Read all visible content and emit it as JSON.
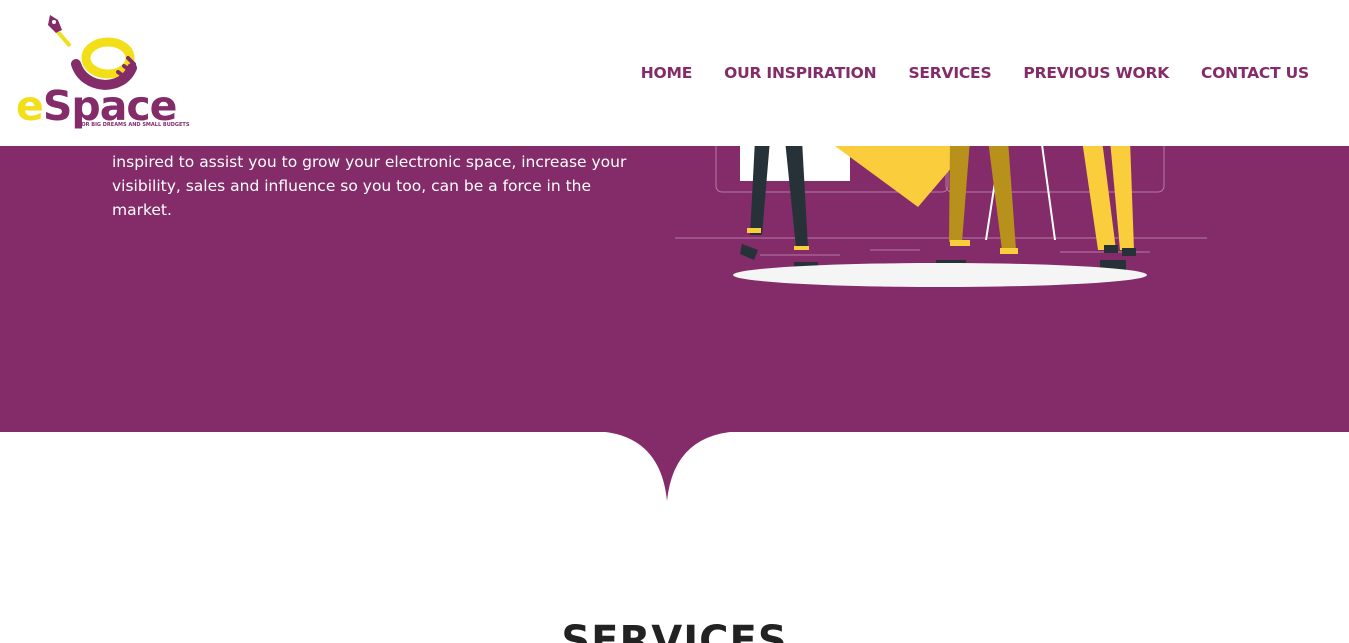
{
  "brand": {
    "name_e": "e",
    "name_rest": "Space",
    "tagline": "FOR BIG DREAMS AND SMALL BUDGETS",
    "colors": {
      "primary": "#832c69",
      "accent": "#f2df1a"
    }
  },
  "nav": {
    "items": [
      {
        "label": "HOME"
      },
      {
        "label": "OUR INSPIRATION"
      },
      {
        "label": "SERVICES"
      },
      {
        "label": "PREVIOUS WORK"
      },
      {
        "label": "CONTACT US"
      }
    ]
  },
  "hero": {
    "partial_line": "your event, but you don't have the same sized budget. We are inspired to",
    "body": "assist you to grow your electronic space, increase your visibility, sales and influence so you too, can be a force in the market.",
    "illustration": "people-at-board-illustration"
  },
  "services": {
    "title": "SERVICES"
  }
}
